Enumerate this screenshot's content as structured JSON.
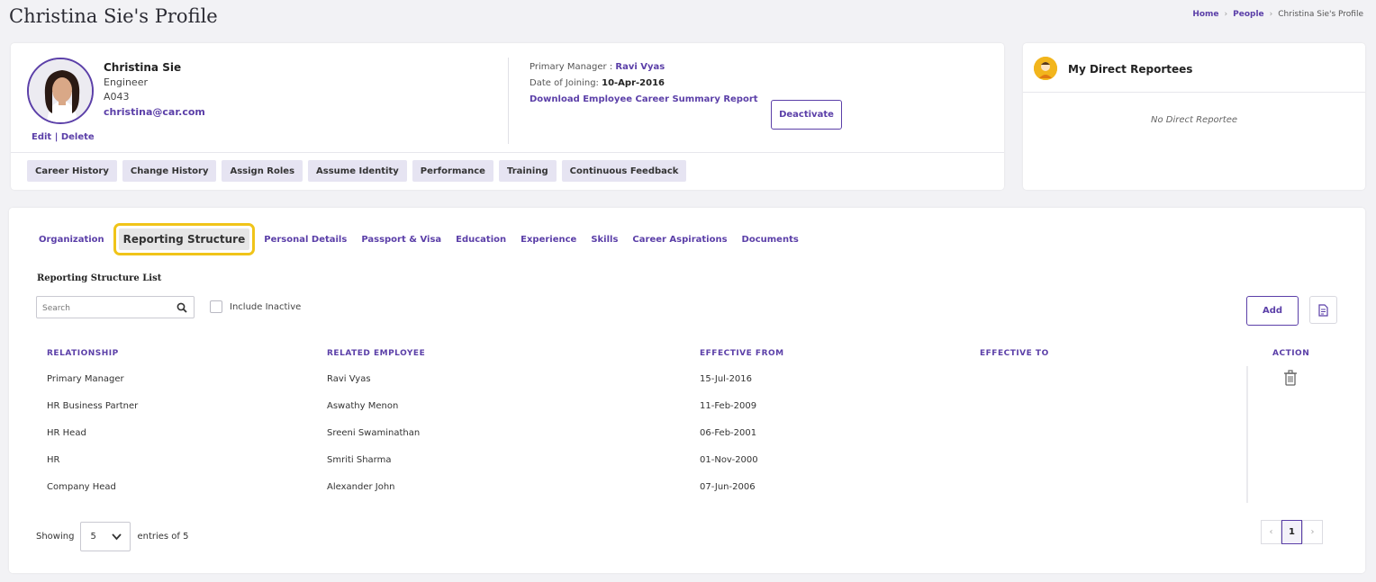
{
  "page": {
    "title": "Christina Sie's Profile",
    "breadcrumb": [
      "Home",
      "People",
      "Christina Sie's Profile"
    ]
  },
  "profile": {
    "name": "Christina Sie",
    "role": "Engineer",
    "code": "A043",
    "email": "christina@car.com",
    "edit_label": "Edit",
    "separator": "|",
    "delete_label": "Delete",
    "primary_manager_label": "Primary Manager :",
    "primary_manager": "Ravi Vyas",
    "doj_label": "Date of Joining:",
    "doj": "10-Apr-2016",
    "download_link": "Download Employee Career Summary Report",
    "deactivate_label": "Deactivate",
    "actions": [
      "Career History",
      "Change History",
      "Assign Roles",
      "Assume Identity",
      "Performance",
      "Training",
      "Continuous Feedback"
    ]
  },
  "reportees": {
    "title": "My Direct Reportees",
    "empty_text": "No Direct Reportee"
  },
  "tabs": {
    "items": [
      "Organization",
      "Reporting Structure",
      "Personal Details",
      "Passport & Visa",
      "Education",
      "Experience",
      "Skills",
      "Career Aspirations",
      "Documents"
    ],
    "active": "Reporting Structure"
  },
  "list": {
    "title": "Reporting Structure List",
    "search_placeholder": "Search",
    "include_inactive_label": "Include Inactive",
    "add_label": "Add",
    "headers": {
      "relationship": "RELATIONSHIP",
      "related_employee": "RELATED EMPLOYEE",
      "effective_from": "EFFECTIVE FROM",
      "effective_to": "EFFECTIVE TO",
      "action": "ACTION"
    },
    "rows": [
      {
        "relationship": "Primary Manager",
        "employee": "Ravi Vyas",
        "from": "15-Jul-2016",
        "to": ""
      },
      {
        "relationship": "HR Business Partner",
        "employee": "Aswathy Menon",
        "from": "11-Feb-2009",
        "to": ""
      },
      {
        "relationship": "HR Head",
        "employee": "Sreeni Swaminathan",
        "from": "06-Feb-2001",
        "to": ""
      },
      {
        "relationship": "HR",
        "employee": "Smriti Sharma",
        "from": "01-Nov-2000",
        "to": ""
      },
      {
        "relationship": "Company Head",
        "employee": "Alexander John",
        "from": "07-Jun-2006",
        "to": ""
      }
    ],
    "showing_label": "Showing",
    "page_size": "5",
    "entries_label": "entries of 5",
    "pager": {
      "prev": "‹",
      "current": "1",
      "next": "›"
    }
  },
  "colors": {
    "accent": "#5b3fa8",
    "highlight": "#f0c419",
    "chip_bg": "#e6e4f2"
  },
  "icons": [
    "search-icon",
    "trash-icon",
    "export-icon",
    "chevron-down-icon",
    "reportee-avatar-icon",
    "breadcrumb-chevron-icon"
  ]
}
